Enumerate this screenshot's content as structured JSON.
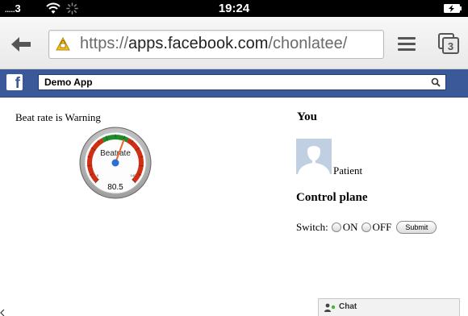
{
  "status_bar": {
    "carrier_dots": ".....",
    "signal": "3",
    "time": "19:24"
  },
  "browser": {
    "url_scheme": "https://",
    "url_domain": "apps.facebook.com",
    "url_path": "/chonlatee/",
    "tab_count": "3"
  },
  "fb_bar": {
    "logo": "f",
    "app_name": "Demo App"
  },
  "beat": {
    "status_text": "Beat rate is Warning",
    "gauge_title": "Beatrate",
    "gauge_value": "80.5",
    "gauge_min_label": "0",
    "gauge_max_label": "140",
    "gauge_min": 0,
    "gauge_max": 140,
    "reading": 80.5
  },
  "user": {
    "heading": "You",
    "name": "Patient"
  },
  "control": {
    "heading": "Control plane",
    "switch_label": "Switch:",
    "on_label": "ON",
    "off_label": "OFF",
    "submit_label": "Submit"
  },
  "chat": {
    "label": "Chat"
  },
  "colors": {
    "facebook_blue": "#3b5998",
    "gauge_red": "#d42e12",
    "gauge_green": "#1f8c2a",
    "needle": "#e9672b"
  }
}
